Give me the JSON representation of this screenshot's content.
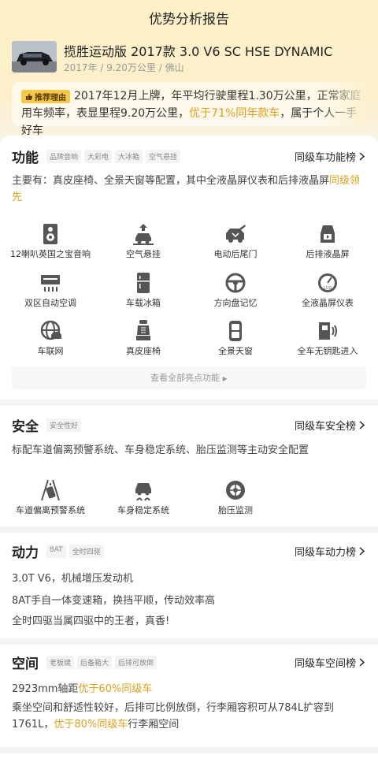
{
  "page": {
    "title": "优势分析报告"
  },
  "car": {
    "title": "揽胜运动版 2017款 3.0 V6 SC HSE DYNAMIC",
    "meta": "2017年 / 9.20万公里 / 佛山"
  },
  "reason": {
    "tag": "推荐理由",
    "text_part1": "2017年12月上牌，年平均行驶里程1.30万公里，正常家庭用车频率，表显里程9.20万公里，",
    "text_highlight": "优于71%同年款车",
    "text_part2": "，属于个人一手好车"
  },
  "features": {
    "title": "功能",
    "tags": [
      "品牌音响",
      "大彩电",
      "大冰箱",
      "空气悬挂"
    ],
    "rank_label": "同级车功能榜",
    "desc_main": "主要有：真皮座椅、全景天窗等配置，其中全液晶屏仪表和后排液晶屏",
    "desc_highlight": "同级领先",
    "items": [
      {
        "label": "12喇叭英国之宝音响",
        "icon": "speaker-icon"
      },
      {
        "label": "空气悬挂",
        "icon": "air-suspension-icon"
      },
      {
        "label": "电动后尾门",
        "icon": "power-tailgate-icon"
      },
      {
        "label": "后排液晶屏",
        "icon": "rear-screen-icon"
      },
      {
        "label": "双区自动空调",
        "icon": "dual-zone-ac-icon"
      },
      {
        "label": "车载冰箱",
        "icon": "fridge-icon"
      },
      {
        "label": "方向盘记忆",
        "icon": "steering-memory-icon"
      },
      {
        "label": "全液晶屏仪表",
        "icon": "lcd-cluster-icon"
      },
      {
        "label": "车联网",
        "icon": "connected-car-icon"
      },
      {
        "label": "真皮座椅",
        "icon": "leather-seat-icon"
      },
      {
        "label": "全景天窗",
        "icon": "panoramic-sunroof-icon"
      },
      {
        "label": "全车无钥匙进入",
        "icon": "keyless-entry-icon"
      }
    ],
    "view_all": "查看全部亮点功能"
  },
  "safety": {
    "title": "安全",
    "tags": [
      "安全性好"
    ],
    "rank_label": "同级车安全榜",
    "desc": "标配车道偏离预警系统、车身稳定系统、胎压监测等主动安全配置",
    "items": [
      {
        "label": "车道偏离预警系统",
        "icon": "lane-departure-icon"
      },
      {
        "label": "车身稳定系统",
        "icon": "stability-control-icon"
      },
      {
        "label": "胎压监测",
        "icon": "tire-pressure-icon"
      }
    ]
  },
  "power": {
    "title": "动力",
    "tags": [
      "8AT",
      "全时四驱"
    ],
    "rank_label": "同级车动力榜",
    "lines": [
      "3.0T V6，机械增压发动机",
      "8AT手自一体变速箱，换挡平顺，传动效率高",
      "全时四驱当属四驱中的王者，真香!"
    ]
  },
  "space": {
    "title": "空间",
    "tags": [
      "老板键",
      "后备箱大",
      "后排可放倒"
    ],
    "rank_label": "同级车空间榜",
    "wheelbase_text": "2923mm轴距",
    "wheelbase_highlight": "优于60%同级车",
    "desc_main": "乘坐空间和舒适性较好，后排可比例放倒，行李厢容积可从784L扩容到1761L，",
    "desc_highlight": "优于80%同级车",
    "desc_tail": "行李厢空间"
  },
  "colors": {
    "accent": "#d9a21b",
    "tag_bg": "#f6c84a",
    "header_bg": "#fdf1c8"
  }
}
